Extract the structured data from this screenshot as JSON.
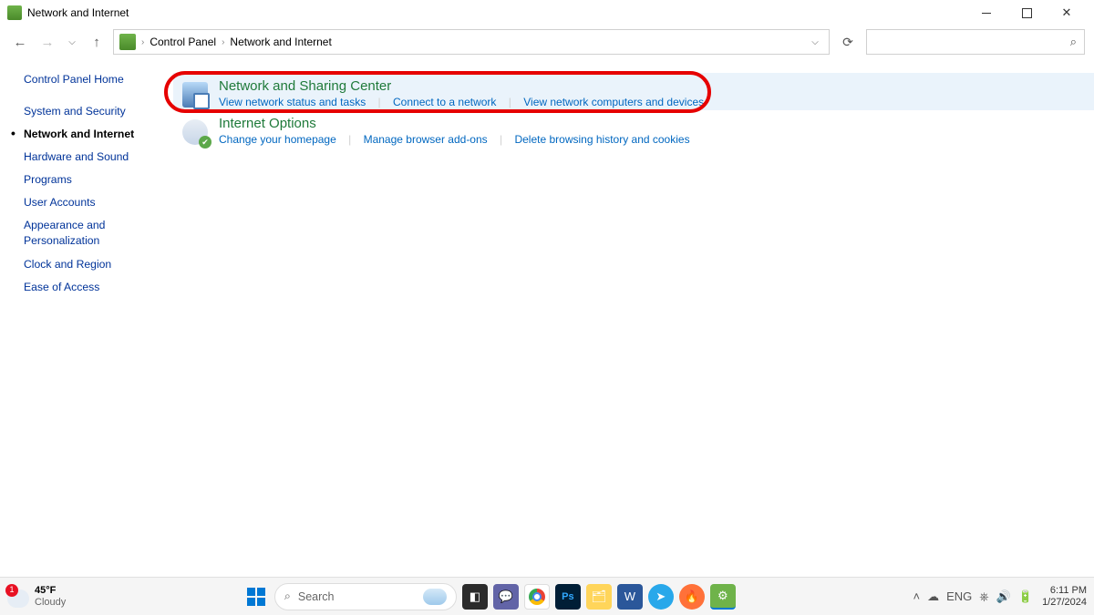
{
  "window": {
    "title": "Network and Internet"
  },
  "breadcrumb": {
    "root": "Control Panel",
    "current": "Network and Internet"
  },
  "sidebar": {
    "home": "Control Panel Home",
    "items": [
      {
        "label": "System and Security"
      },
      {
        "label": "Network and Internet",
        "active": true
      },
      {
        "label": "Hardware and Sound"
      },
      {
        "label": "Programs"
      },
      {
        "label": "User Accounts"
      },
      {
        "label": "Appearance and Personalization"
      },
      {
        "label": "Clock and Region"
      },
      {
        "label": "Ease of Access"
      }
    ]
  },
  "sections": {
    "network_sharing": {
      "title": "Network and Sharing Center",
      "links": [
        "View network status and tasks",
        "Connect to a network",
        "View network computers and devices"
      ]
    },
    "internet_options": {
      "title": "Internet Options",
      "links": [
        "Change your homepage",
        "Manage browser add-ons",
        "Delete browsing history and cookies"
      ]
    }
  },
  "taskbar": {
    "weather": {
      "badge": "1",
      "temp": "45°F",
      "desc": "Cloudy"
    },
    "search_placeholder": "Search",
    "lang": "ENG",
    "time": "6:11 PM",
    "date": "1/27/2024"
  }
}
